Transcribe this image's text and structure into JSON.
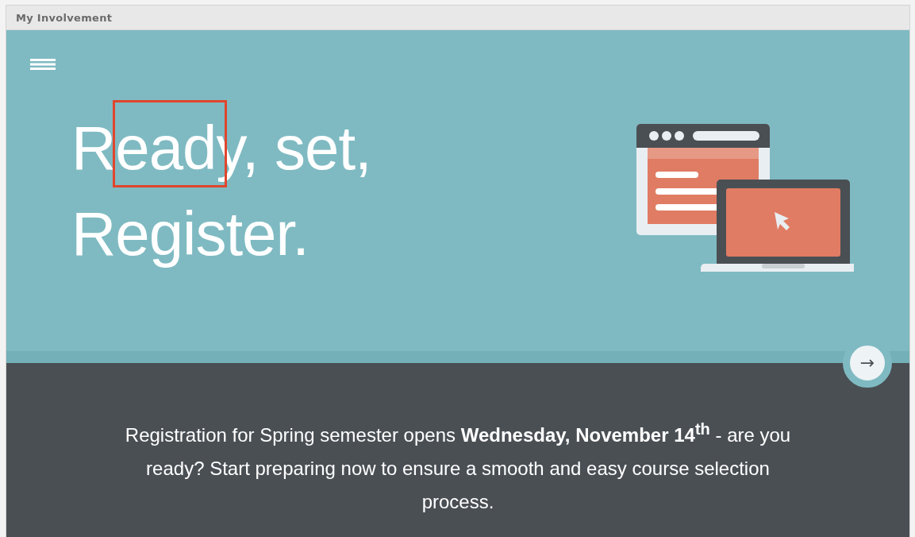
{
  "window": {
    "title": "My Involvement"
  },
  "hero": {
    "heading_lines": [
      "Ready, set,",
      "Register."
    ],
    "annotation": {
      "kind": "box",
      "color": "#e0452e"
    },
    "next_button": {
      "label": "→"
    }
  },
  "announcement": {
    "text": "Registration for Spring semester opens **Wednesday, November 14$^{th}$** - are you ready? Start preparing now to ensure a smooth and easy course selection process."
  }
}
